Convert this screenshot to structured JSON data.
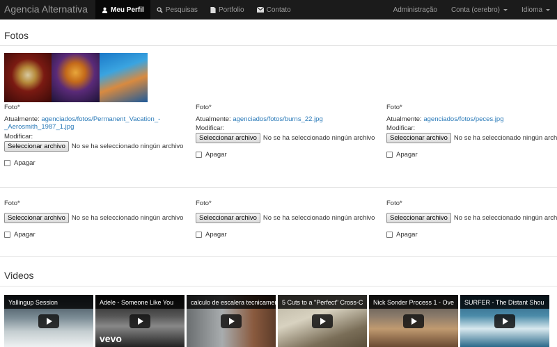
{
  "navbar": {
    "brand": "Agencia Alternativa",
    "items": [
      {
        "label": "Meu Perfil",
        "icon": "user-icon",
        "active": true
      },
      {
        "label": "Pesquisas",
        "icon": "search-icon",
        "active": false
      },
      {
        "label": "Portfolio",
        "icon": "file-icon",
        "active": false
      },
      {
        "label": "Contato",
        "icon": "envelope-icon",
        "active": false
      }
    ],
    "right": [
      {
        "label": "Administração"
      },
      {
        "label": "Conta (cerebro)",
        "dropdown": true
      },
      {
        "label": "Idioma",
        "dropdown": true
      }
    ]
  },
  "fotos": {
    "title": "Fotos",
    "groups": [
      {
        "label": "Foto*",
        "current_prefix": "Atualmente:",
        "current_link": "agenciados/fotos/Permanent_Vacation_-",
        "current_link2": "_Aerosmith_1987_1.jpg",
        "modify": "Modificar:",
        "button": "Seleccionar archivo",
        "nofile": "No se ha seleccionado ningún archivo",
        "clear": "Apagar"
      },
      {
        "label": "Foto*",
        "current_prefix": "Atualmente:",
        "current_link": "agenciados/fotos/burns_22.jpg",
        "modify": "Modificar:",
        "button": "Seleccionar archivo",
        "nofile": "No se ha seleccionado ningún archivo",
        "clear": "Apagar"
      },
      {
        "label": "Foto*",
        "current_prefix": "Atualmente:",
        "current_link": "agenciados/fotos/peces.jpg",
        "modify": "Modificar:",
        "button": "Seleccionar archivo",
        "nofile": "No se ha seleccionado ningún archivo",
        "clear": "Apagar"
      },
      {
        "label": "Foto*",
        "button": "Seleccionar archivo",
        "nofile": "No se ha seleccionado ningún archivo",
        "clear": "Apagar"
      },
      {
        "label": "Foto*",
        "button": "Seleccionar archivo",
        "nofile": "No se ha seleccionado ningún archivo",
        "clear": "Apagar"
      },
      {
        "label": "Foto*",
        "button": "Seleccionar archivo",
        "nofile": "No se ha seleccionado ningún archivo",
        "clear": "Apagar"
      }
    ]
  },
  "videos": {
    "title": "Videos",
    "items": [
      {
        "title": "Yallingup Session"
      },
      {
        "title": "Adele - Someone Like You",
        "badge": "vevo"
      },
      {
        "title": "calculo de escalera tecnicamente"
      },
      {
        "title": "5 Cuts to a \"Perfect\" Cross-C"
      },
      {
        "title": "Nick Sonder Process 1 - Ove"
      },
      {
        "title": "SURFER - The Distant Shou"
      }
    ]
  },
  "colors": {
    "navbar_bg": "#1b1b1b",
    "link": "#2a7ab8"
  }
}
